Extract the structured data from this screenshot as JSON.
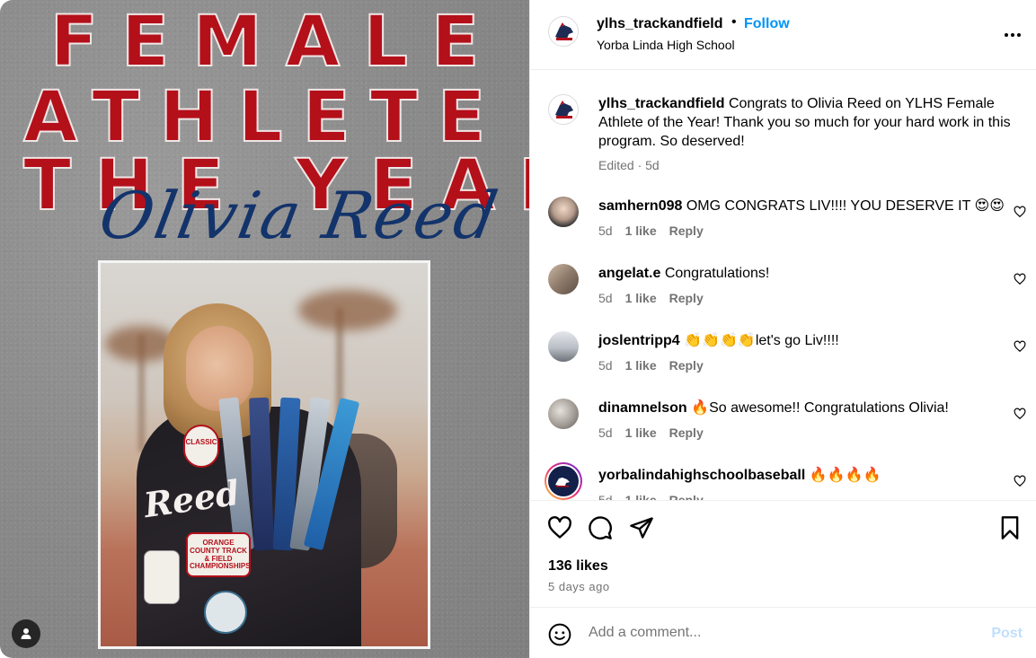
{
  "media": {
    "headline_line1": "FEMALE",
    "headline_line2": "ATHLETE OF",
    "headline_line3": "THE YEAR",
    "script_name": "Olivia Reed",
    "jacket_name": "Reed",
    "patch1": "CLASSIC",
    "patch2": "ORANGE COUNTY TRACK & FIELD CHAMPIONSHIPS",
    "colors": {
      "headline": "#b3101a",
      "script": "#13336b",
      "background": "#8c8c8c"
    }
  },
  "header": {
    "username": "ylhs_trackandfield",
    "separator": "•",
    "follow_label": "Follow",
    "subtitle": "Yorba Linda High School",
    "more_icon": "more-horizontal-icon"
  },
  "caption": {
    "username": "ylhs_trackandfield",
    "text": "Congrats to Olivia Reed on YLHS Female Athlete of the Year! Thank you so much for your hard work in this program. So deserved!",
    "meta": "Edited · 5d"
  },
  "comments": [
    {
      "username": "samhern098",
      "text": "OMG CONGRATS LIV!!!! YOU DESERVE IT 😍😍",
      "age": "5d",
      "likes": "1 like",
      "reply": "Reply"
    },
    {
      "username": "angelat.e",
      "text": "Congratulations!",
      "age": "5d",
      "likes": "1 like",
      "reply": "Reply"
    },
    {
      "username": "joslentripp4",
      "text": "👏👏👏👏let's go Liv!!!!",
      "age": "5d",
      "likes": "1 like",
      "reply": "Reply"
    },
    {
      "username": "dinamnelson",
      "text": "🔥So awesome!! Congratulations Olivia!",
      "age": "5d",
      "likes": "1 like",
      "reply": "Reply"
    },
    {
      "username": "yorbalindahighschoolbaseball",
      "text": "🔥🔥🔥🔥",
      "age": "5d",
      "likes": "1 like",
      "reply": "Reply"
    }
  ],
  "actions": {
    "likes": "136 likes",
    "ago": "5 days ago"
  },
  "add_comment": {
    "placeholder": "Add a comment...",
    "post_label": "Post"
  },
  "accent": "#0095f6"
}
